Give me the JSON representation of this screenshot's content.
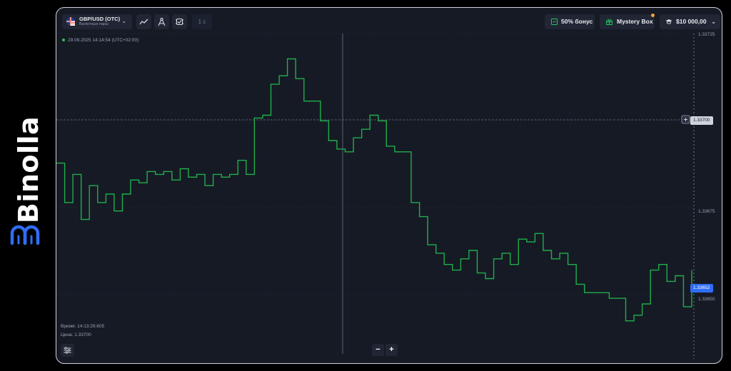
{
  "brand": {
    "name": "Binolla"
  },
  "header": {
    "pair_name": "GBP/USD (OTC)",
    "pair_category": "Валютные пары",
    "timeframe": "1 c",
    "bonus_label": "50% бонус",
    "mystery_box_label": "Mystery Box",
    "balance": "$10 000,00"
  },
  "chart_info": {
    "datetime": "29.09.2025  14:14:54  (UTC+02:00)"
  },
  "crosshair": {
    "time_label": "Время: 14:13:29.605",
    "price_label": "Цена: 1.33700",
    "price_tag": "1.33700"
  },
  "current_price": "1.33652",
  "axis": {
    "ticks": [
      "1.33725",
      "1.33675",
      "1.33650"
    ]
  },
  "zoom": {
    "minus": "−",
    "plus": "+"
  },
  "colors": {
    "line": "#1fae4b",
    "background": "#161a25",
    "current_price_tag": "#2f6df6",
    "brand": "#2f6df6"
  },
  "chart_data": {
    "type": "line",
    "series": [
      {
        "values": [
          1.33694,
          1.3368,
          1.3369,
          1.33674,
          1.33686,
          1.3368,
          1.33683,
          1.33677,
          1.33683,
          1.33688,
          1.33687,
          1.33691,
          1.3369,
          1.33691,
          1.33688,
          1.33692,
          1.33689,
          1.3369,
          1.33686,
          1.3369,
          1.33689,
          1.3369,
          1.33695,
          1.3369,
          1.3371,
          1.33711,
          1.33722,
          1.33725,
          1.33731,
          1.33724,
          1.33716,
          1.33716,
          1.33709,
          1.33702,
          1.33699,
          1.33698,
          1.33703,
          1.33706,
          1.33711,
          1.33709,
          1.337,
          1.33698,
          1.33698,
          1.3368,
          1.33675,
          1.33665,
          1.33662,
          1.33658,
          1.33656,
          1.3366,
          1.33663,
          1.33655,
          1.33653,
          1.3366,
          1.33662,
          1.33658,
          1.33667,
          1.33666,
          1.33669,
          1.33663,
          1.3366,
          1.33662,
          1.33658,
          1.33651,
          1.33648,
          1.33648,
          1.33648,
          1.33646,
          1.33646,
          1.33638,
          1.3364,
          1.33644,
          1.33656,
          1.33658,
          1.33652,
          1.33654,
          1.33643,
          1.33656
        ]
      }
    ],
    "ylim": [
      1.33625,
      1.3374
    ]
  }
}
